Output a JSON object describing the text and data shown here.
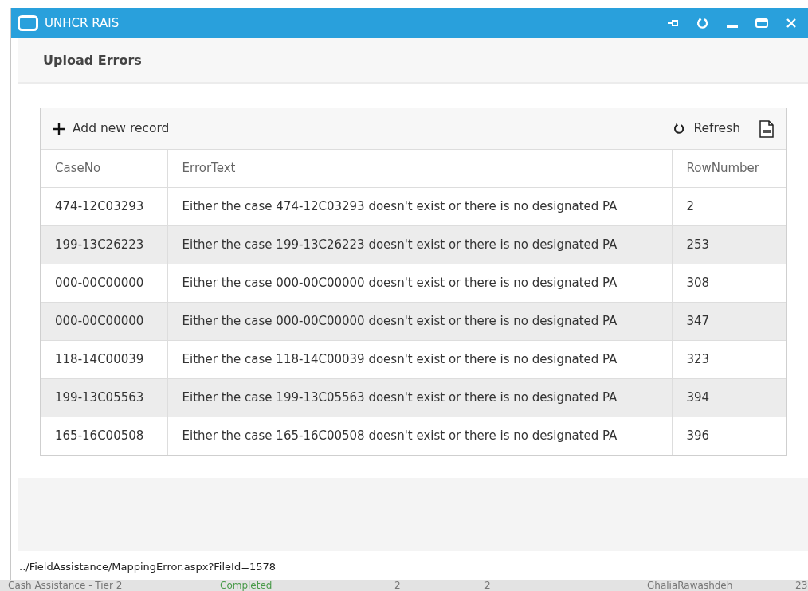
{
  "window": {
    "title": "UNHCR RAIS"
  },
  "page_title": "Upload Errors",
  "toolbar": {
    "add_label": "Add new record",
    "refresh_label": "Refresh"
  },
  "table": {
    "columns": [
      "CaseNo",
      "ErrorText",
      "RowNumber"
    ],
    "rows": [
      [
        "474-12C03293",
        "Either the case 474-12C03293 doesn't exist or there is no designated PA",
        "2"
      ],
      [
        "199-13C26223",
        "Either the case 199-13C26223 doesn't exist or there is no designated PA",
        "253"
      ],
      [
        "000-00C00000",
        "Either the case 000-00C00000 doesn't exist or there is no designated PA",
        "308"
      ],
      [
        "000-00C00000",
        "Either the case 000-00C00000 doesn't exist or there is no designated PA",
        "347"
      ],
      [
        "118-14C00039",
        "Either the case 118-14C00039 doesn't exist or there is no designated PA",
        "323"
      ],
      [
        "199-13C05563",
        "Either the case 199-13C05563 doesn't exist or there is no designated PA",
        "394"
      ],
      [
        "165-16C00508",
        "Either the case 165-16C00508 doesn't exist or there is no designated PA",
        "396"
      ]
    ]
  },
  "status_bar": "../FieldAssistance/MappingError.aspx?FileId=1578",
  "background_row": [
    "Cash Assistance - Tier 2",
    "Completed",
    "2",
    "2",
    "GhaliaRawashdeh",
    "23"
  ]
}
